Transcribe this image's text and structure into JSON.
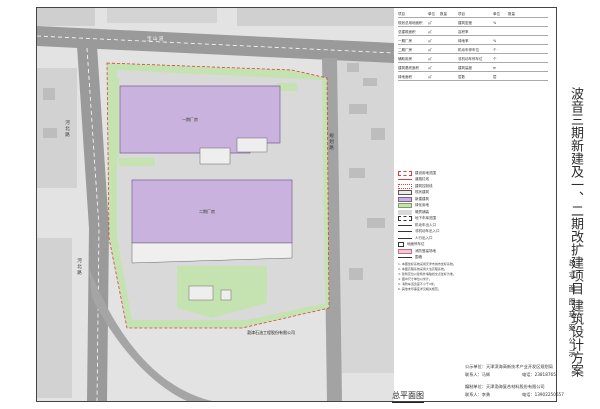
{
  "project": {
    "title": "波音三期新建及一、二期改扩建项目 建筑设计方案",
    "subtitle": "总平面图草案公示"
  },
  "map": {
    "title": "总平面图",
    "road_north": "宝 山 道",
    "road_west": "河 北 路",
    "road_southwest": "河 北 路",
    "road_east": "规 划 路",
    "building_1": "一期厂房",
    "building_2": "二期厂房",
    "company": "渤津石油工程股份有限公司",
    "colors": {
      "building": "#c9b3de",
      "green": "#c5e3b0",
      "road": "#9a9a9a",
      "ground": "#d9d9d9",
      "redline": "#d84040"
    }
  },
  "legend": [
    {
      "label": "建设用地范围",
      "style": "red-dash"
    },
    {
      "label": "道路红线",
      "style": "red-solid"
    },
    {
      "label": "建筑控制线",
      "style": "red-dot"
    },
    {
      "label": "现状建筑",
      "style": "gray-box"
    },
    {
      "label": "新建建筑",
      "style": "purple-box"
    },
    {
      "label": "绿化用地",
      "style": "green-box"
    },
    {
      "label": "硬质铺装",
      "style": "gray-fill"
    },
    {
      "label": "地下车库范围",
      "style": "dash-box"
    },
    {
      "label": "机动车出入口",
      "style": "arrow"
    },
    {
      "label": "非机动车出入口",
      "style": "arrow"
    },
    {
      "label": "人行出入口",
      "style": "arrow"
    },
    {
      "label": "地面停车位",
      "style": "small-box"
    },
    {
      "label": "消防登高场地",
      "style": "pink-box"
    },
    {
      "label": "围墙",
      "style": "line"
    }
  ],
  "notes": [
    "1. 本图坐标系统采用天津市城市坐标系统。",
    "2. 本图高程系统采用大沽高程系统。",
    "3. 建筑定位以建筑外墙轴线交点坐标为准。",
    "4. 图中尺寸单位以米计。",
    "5. 消防车道宽度不小于4米。",
    "6. 其他未尽事宜详见相关规范。"
  ],
  "info": {
    "row1": "公示单位：天津滨海高新技术产业开发区规划局",
    "row2_contact": "联系人：马辉",
    "row2_phone": "电话：23818765",
    "row3": "编制单位：天津渤海复合材料股份有限公司",
    "row4_contact": "联系人：李勇",
    "row4_phone": "电话：13902250657"
  },
  "table": {
    "rows": [
      [
        "项目",
        "单位",
        "数量",
        "项目",
        "单位",
        "数量"
      ],
      [
        "规划总用地面积",
        "㎡",
        "",
        "建筑密度",
        "%",
        ""
      ],
      [
        "总建筑面积",
        "㎡",
        "",
        "容积率",
        "",
        ""
      ],
      [
        "一期厂房",
        "㎡",
        "",
        "绿地率",
        "%",
        ""
      ],
      [
        "二期厂房",
        "㎡",
        "",
        "机动车停车位",
        "个",
        ""
      ],
      [
        "辅助用房",
        "㎡",
        "",
        "非机动车停车位",
        "个",
        ""
      ],
      [
        "建筑基底面积",
        "㎡",
        "",
        "建筑高度",
        "m",
        ""
      ],
      [
        "绿地面积",
        "㎡",
        "",
        "层数",
        "层",
        ""
      ]
    ]
  }
}
